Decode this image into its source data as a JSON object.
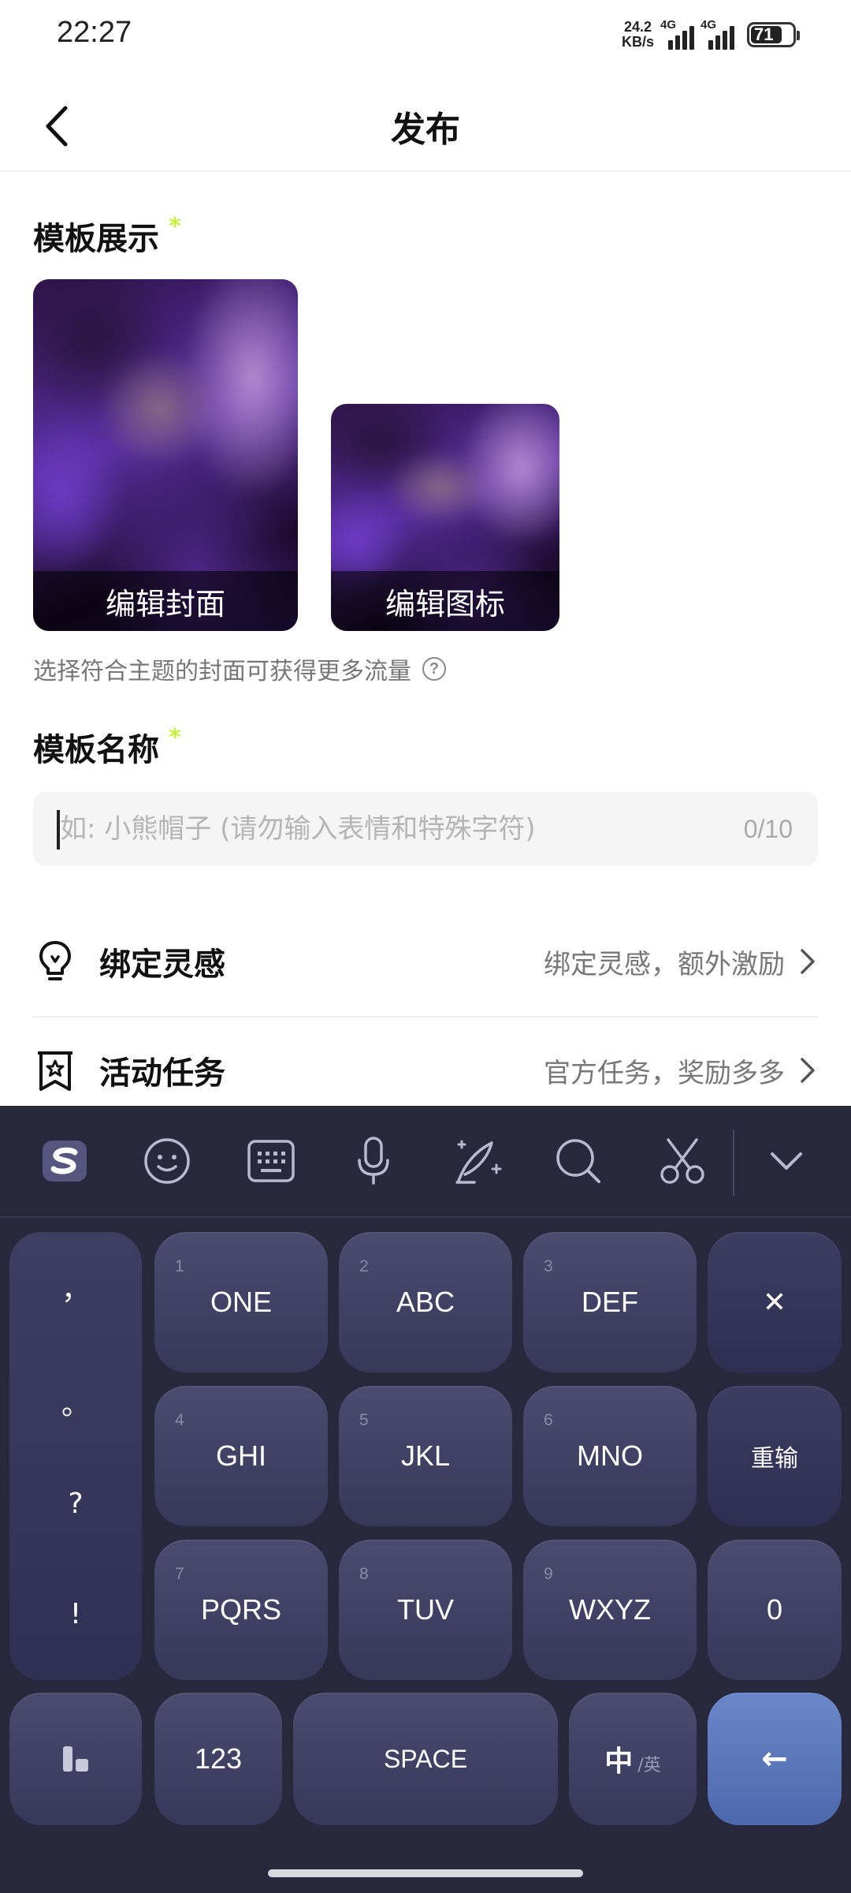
{
  "status_bar": {
    "time": "22:27",
    "net_speed_value": "24.2",
    "net_speed_unit": "KB/s",
    "signal1_label": "4G",
    "signal2_label": "4G",
    "battery": "71"
  },
  "header": {
    "title": "发布",
    "back_icon": "chevron-left-icon"
  },
  "template_display": {
    "title": "模板展示",
    "required_mark": "*",
    "cover_caption": "编辑封面",
    "icon_caption": "编辑图标",
    "hint": "选择符合主题的封面可获得更多流量",
    "hint_icon": "?"
  },
  "template_name": {
    "title": "模板名称",
    "required_mark": "*",
    "placeholder": "如: 小熊帽子 (请勿输入表情和特殊字符)",
    "value": "",
    "counter": "0/10"
  },
  "rows": [
    {
      "icon": "lightbulb-icon",
      "label": "绑定灵感",
      "value": "绑定灵感，额外激励"
    },
    {
      "icon": "bookmark-star-icon",
      "label": "活动任务",
      "value": "官方任务，奖励多多"
    }
  ],
  "keyboard": {
    "toolbar_icons": [
      "sogou-logo-icon",
      "emoji-icon",
      "keyboard-icon",
      "microphone-icon",
      "handwriting-icon",
      "search-icon",
      "scissors-icon",
      "collapse-chevron-icon"
    ],
    "symbols": [
      "，",
      "。",
      "?",
      "!"
    ],
    "keys": [
      {
        "num": "1",
        "label": "ONE"
      },
      {
        "num": "2",
        "label": "ABC"
      },
      {
        "num": "3",
        "label": "DEF"
      },
      {
        "num": "4",
        "label": "GHI"
      },
      {
        "num": "5",
        "label": "JKL"
      },
      {
        "num": "6",
        "label": "MNO"
      },
      {
        "num": "7",
        "label": "PQRS"
      },
      {
        "num": "8",
        "label": "TUV"
      },
      {
        "num": "9",
        "label": "WXYZ"
      }
    ],
    "delete_label": "✕",
    "reinput_label": "重输",
    "zero_label": "0",
    "num_label": "123",
    "space_label": "SPACE",
    "lang_main": "中",
    "lang_sub": "/英",
    "enter_label": "←"
  }
}
